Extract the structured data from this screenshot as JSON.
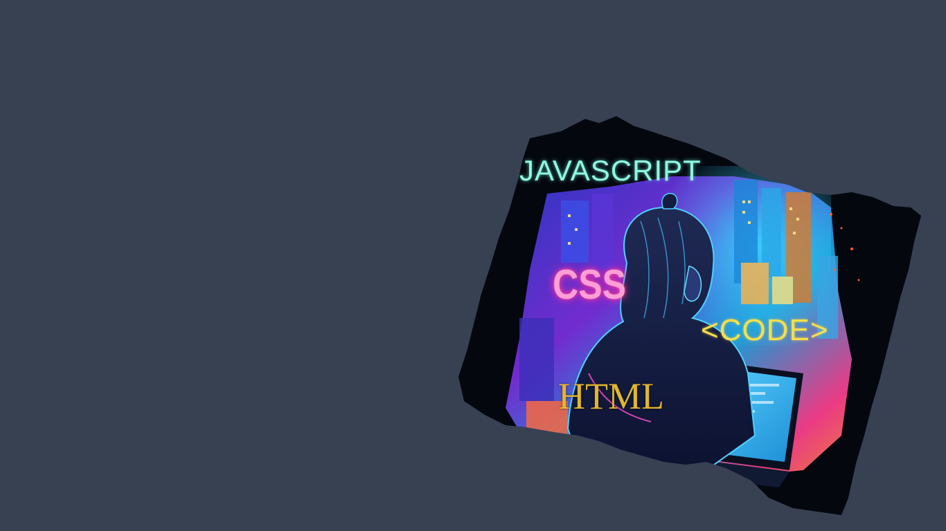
{
  "colors": {
    "background": "#374151",
    "js_label": "#8ff7e0",
    "css_label": "#ff9fd6",
    "code_label": "#f6df4c",
    "html_label": "#e2b62e"
  },
  "artwork": {
    "labels": {
      "javascript": "JAVASCRIPT",
      "css": "CSS",
      "code": "<CODE>",
      "html": "HTML"
    }
  }
}
